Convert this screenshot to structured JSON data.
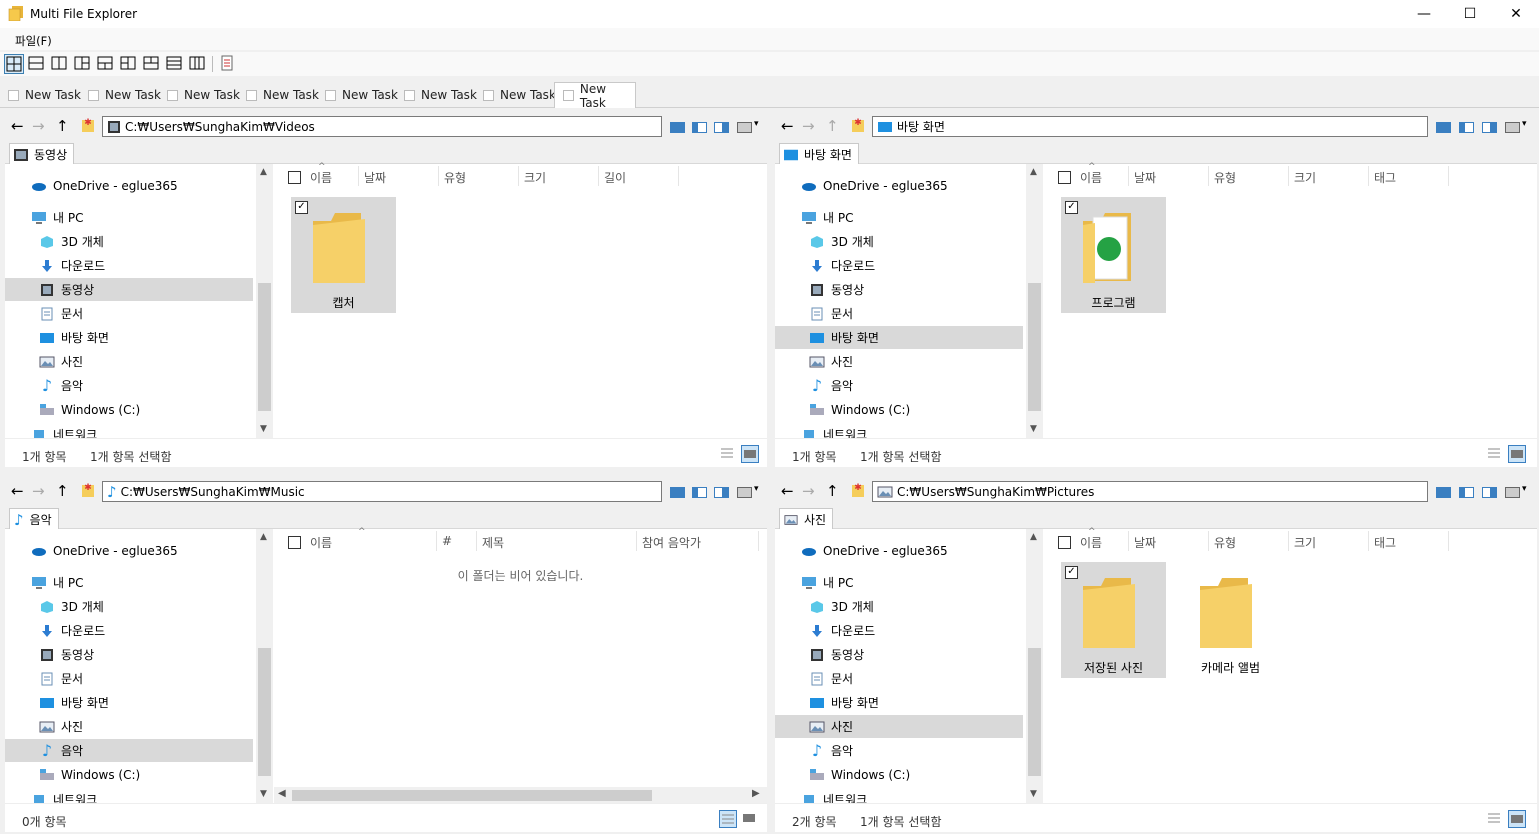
{
  "window": {
    "title": "Multi File Explorer",
    "minimize": "—",
    "maximize": "☐",
    "close": "✕"
  },
  "menu": {
    "file": "파일(F)"
  },
  "tabs": [
    "New Task",
    "New Task",
    "New Task",
    "New Task",
    "New Task",
    "New Task",
    "New Task",
    "New Task"
  ],
  "tree_labels": {
    "onedrive": "OneDrive - eglue365",
    "mypc": "내 PC",
    "objects3d": "3D 개체",
    "downloads": "다운로드",
    "videos": "동영상",
    "documents": "문서",
    "desktop": "바탕 화면",
    "pictures": "사진",
    "music": "음악",
    "windows": "Windows  (C:)",
    "network": "네트워크"
  },
  "panes": {
    "tl": {
      "path": "C:₩Users₩SunghaKim₩Videos",
      "folder_tab": "동영상",
      "columns": [
        "이름",
        "날짜",
        "유형",
        "크기",
        "길이"
      ],
      "items": [
        {
          "label": "캡처",
          "selected": true
        }
      ],
      "status_count": "1개 항목",
      "status_selected": "1개 항목 선택함"
    },
    "tr": {
      "path": "바탕 화면",
      "folder_tab": "바탕 화면",
      "columns": [
        "이름",
        "날짜",
        "유형",
        "크기",
        "태그"
      ],
      "items": [
        {
          "label": "프로그램",
          "selected": true
        }
      ],
      "status_count": "1개 항목",
      "status_selected": "1개 항목 선택함"
    },
    "bl": {
      "path": "C:₩Users₩SunghaKim₩Music",
      "folder_tab": "음악",
      "columns": [
        "이름",
        "#",
        "제목",
        "참여 음악가"
      ],
      "empty_message": "이 폴더는 비어 있습니다.",
      "status_count": "0개 항목",
      "status_selected": ""
    },
    "br": {
      "path": "C:₩Users₩SunghaKim₩Pictures",
      "folder_tab": "사진",
      "columns": [
        "이름",
        "날짜",
        "유형",
        "크기",
        "태그"
      ],
      "items": [
        {
          "label": "저장된 사진",
          "selected": true
        },
        {
          "label": "카메라 앨범",
          "selected": false
        }
      ],
      "status_count": "2개 항목",
      "status_selected": "1개 항목 선택함"
    }
  },
  "colors": {
    "accent": "#3a7fc1",
    "selection": "#d9d9d9",
    "folder": "#f5cd5a"
  }
}
